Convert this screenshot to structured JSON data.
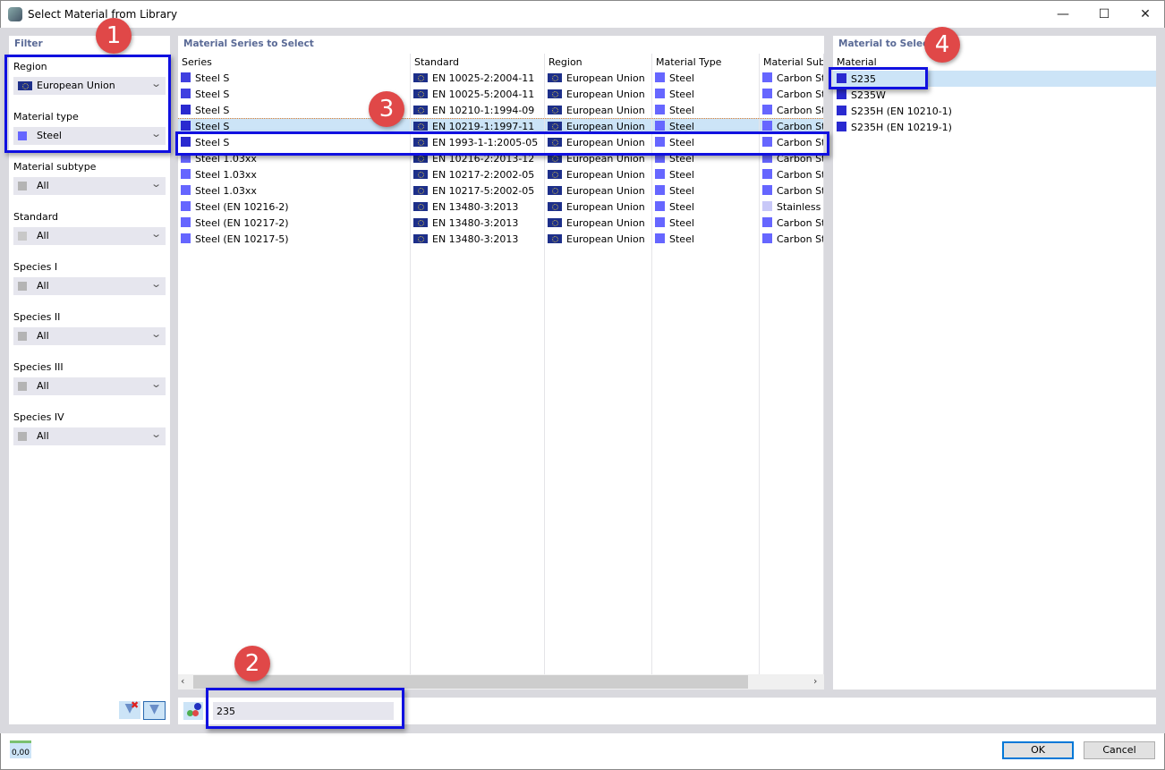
{
  "window": {
    "title": "Select Material from Library",
    "minimize": "—",
    "maximize": "☐",
    "close": "✕"
  },
  "filter": {
    "title": "Filter",
    "fields": [
      {
        "label": "Region",
        "value": "European Union",
        "icon": "eu-flag"
      },
      {
        "label": "Material type",
        "value": "Steel",
        "color": "#6666ff"
      },
      {
        "label": "Material subtype",
        "value": "All",
        "color": "#b4b4b4"
      },
      {
        "label": "Standard",
        "value": "All",
        "color": "#c8c8c8"
      },
      {
        "label": "Species I",
        "value": "All",
        "color": "#b4b4b4"
      },
      {
        "label": "Species II",
        "value": "All",
        "color": "#b4b4b4"
      },
      {
        "label": "Species III",
        "value": "All",
        "color": "#b4b4b4"
      },
      {
        "label": "Species IV",
        "value": "All",
        "color": "#b4b4b4"
      }
    ]
  },
  "series": {
    "title": "Material Series to Select",
    "headers": [
      "Series",
      "Standard",
      "Region",
      "Material Type",
      "Material Subtype"
    ],
    "rows": [
      {
        "series": "Steel S",
        "standard": "EN 10025-2:2004-11",
        "region": "European Union",
        "type": "Steel",
        "subtype": "Carbon St",
        "sc": "#4040e0",
        "stc": "#6666ff"
      },
      {
        "series": "Steel S",
        "standard": "EN 10025-5:2004-11",
        "region": "European Union",
        "type": "Steel",
        "subtype": "Carbon St",
        "sc": "#4040e0",
        "stc": "#6666ff"
      },
      {
        "series": "Steel S",
        "standard": "EN 10210-1:1994-09",
        "region": "European Union",
        "type": "Steel",
        "subtype": "Carbon St",
        "sc": "#2a2ad0",
        "stc": "#6666ff"
      },
      {
        "series": "Steel S",
        "standard": "EN 10219-1:1997-11",
        "region": "European Union",
        "type": "Steel",
        "subtype": "Carbon St",
        "sc": "#2a2ad0",
        "stc": "#6666ff"
      },
      {
        "series": "Steel S",
        "standard": "EN 1993-1-1:2005-05",
        "region": "European Union",
        "type": "Steel",
        "subtype": "Carbon St",
        "sc": "#2a2ad0",
        "stc": "#6666ff"
      },
      {
        "series": "Steel 1.03xx",
        "standard": "EN 10216-2:2013-12",
        "region": "European Union",
        "type": "Steel",
        "subtype": "Carbon St",
        "sc": "#6666ff",
        "stc": "#6666ff"
      },
      {
        "series": "Steel 1.03xx",
        "standard": "EN 10217-2:2002-05",
        "region": "European Union",
        "type": "Steel",
        "subtype": "Carbon St",
        "sc": "#6666ff",
        "stc": "#6666ff"
      },
      {
        "series": "Steel 1.03xx",
        "standard": "EN 10217-5:2002-05",
        "region": "European Union",
        "type": "Steel",
        "subtype": "Carbon St",
        "sc": "#6666ff",
        "stc": "#6666ff"
      },
      {
        "series": "Steel (EN 10216-2)",
        "standard": "EN 13480-3:2013",
        "region": "European Union",
        "type": "Steel",
        "subtype": "Stainless S",
        "sc": "#6666ff",
        "stc": "#c8c8f8"
      },
      {
        "series": "Steel (EN 10217-2)",
        "standard": "EN 13480-3:2013",
        "region": "European Union",
        "type": "Steel",
        "subtype": "Carbon St",
        "sc": "#6666ff",
        "stc": "#6666ff"
      },
      {
        "series": "Steel (EN 10217-5)",
        "standard": "EN 13480-3:2013",
        "region": "European Union",
        "type": "Steel",
        "subtype": "Carbon St",
        "sc": "#6666ff",
        "stc": "#6666ff"
      }
    ],
    "selected_index": 4
  },
  "materials": {
    "title": "Material to Select",
    "header": "Material",
    "items": [
      "S235",
      "S235W",
      "S235H (EN 10210-1)",
      "S235H (EN 10219-1)"
    ],
    "selected_index": 0,
    "color": "#2a2ad0"
  },
  "search": {
    "value": "235"
  },
  "badges": [
    "1",
    "2",
    "3",
    "4"
  ],
  "footer": {
    "units_icon_text": "0,00",
    "ok": "OK",
    "cancel": "Cancel"
  }
}
